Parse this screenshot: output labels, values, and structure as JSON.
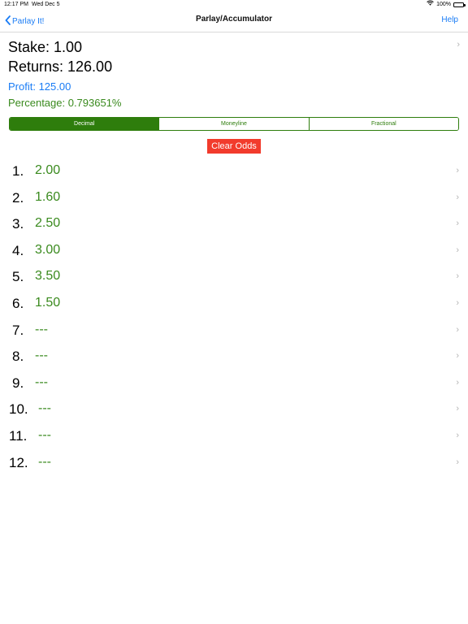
{
  "status_bar": {
    "time": "12:17 PM",
    "date": "Wed Dec 5",
    "battery": "100%",
    "wifi_icon": "wifi-icon",
    "battery_icon": "battery-icon"
  },
  "nav": {
    "back_label": "Parlay It!",
    "title": "Parlay/Accumulator",
    "help_label": "Help"
  },
  "summary": {
    "stake": "Stake: 1.00",
    "returns": "Returns: 126.00",
    "profit": "Profit: 125.00",
    "percentage": "Percentage: 0.793651%"
  },
  "segments": {
    "decimal": "Decimal",
    "moneyline": "Moneyline",
    "fractional": "Fractional",
    "selected": "Decimal"
  },
  "clear_button": "Clear Odds",
  "chevron": "›",
  "colors": {
    "accent_blue": "#1a7cf5",
    "accent_green": "#2e7d0c",
    "value_green": "#3a8a1e",
    "clear_red": "#f23b2c"
  },
  "odds": [
    {
      "number": "1.",
      "value": "2.00"
    },
    {
      "number": "2.",
      "value": "1.60"
    },
    {
      "number": "3.",
      "value": "2.50"
    },
    {
      "number": "4.",
      "value": "3.00"
    },
    {
      "number": "5.",
      "value": "3.50"
    },
    {
      "number": "6.",
      "value": "1.50"
    },
    {
      "number": "7.",
      "value": "---"
    },
    {
      "number": "8.",
      "value": "---"
    },
    {
      "number": "9.",
      "value": "---"
    },
    {
      "number": "10.",
      "value": "---"
    },
    {
      "number": "11.",
      "value": "---"
    },
    {
      "number": "12.",
      "value": "---"
    }
  ]
}
